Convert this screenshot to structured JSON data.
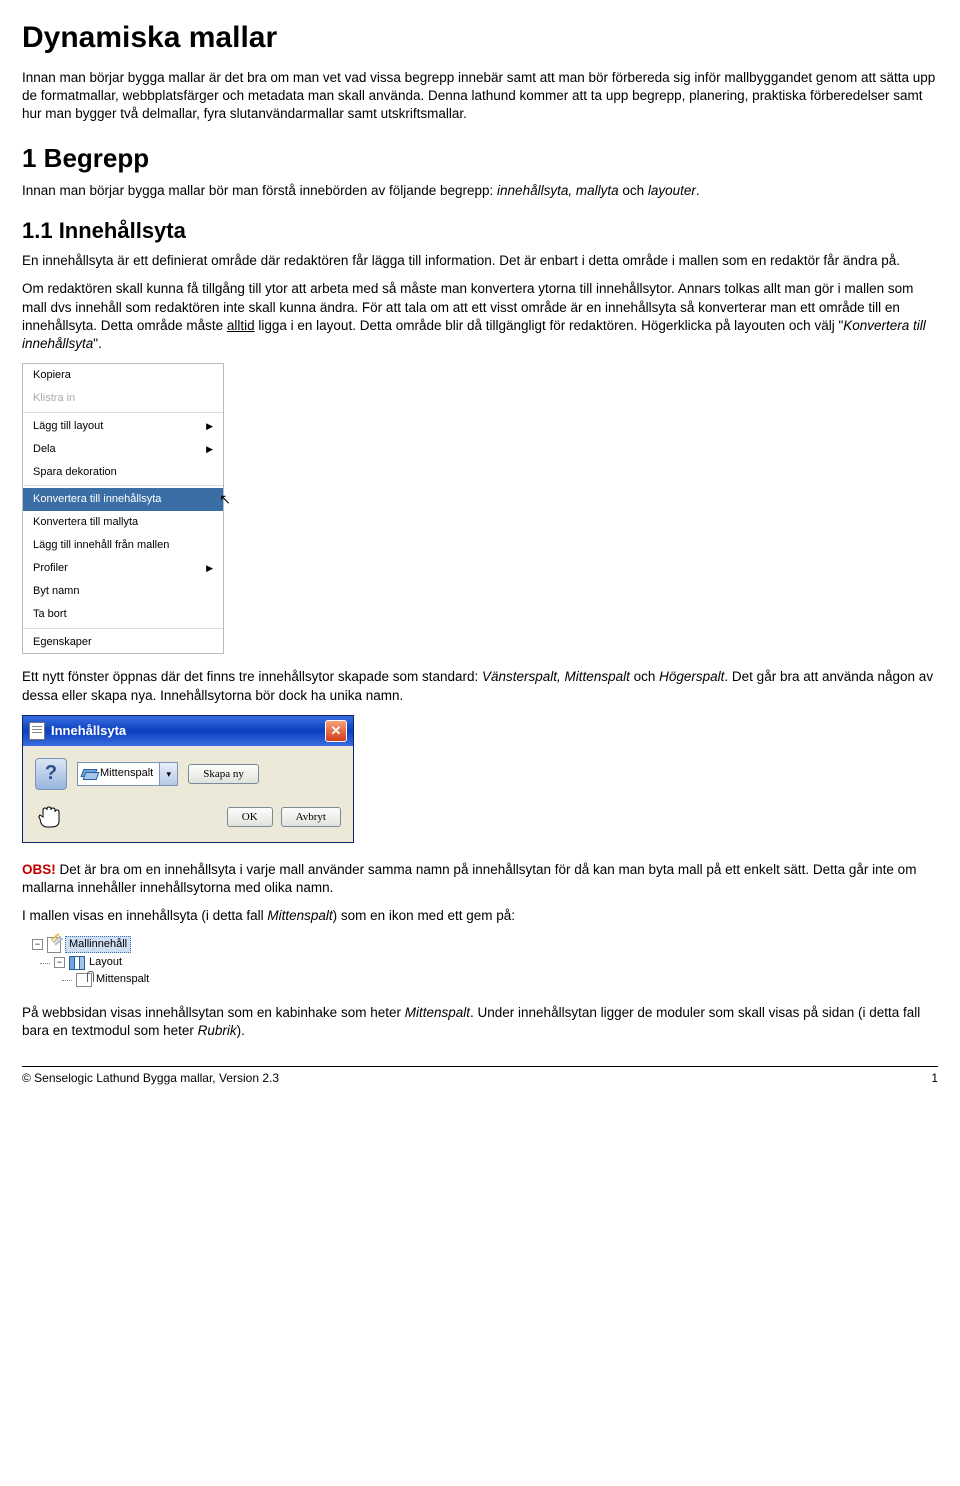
{
  "title": "Dynamiska mallar",
  "intro_p1": "Innan man börjar bygga mallar är det bra om man vet vad vissa begrepp innebär samt att man bör förbereda sig inför mallbyggandet genom att sätta upp de formatmallar, webbplatsfärger och metadata man skall använda. Denna lathund kommer att ta upp begrepp, planering, praktiska förberedelser samt hur man bygger två delmallar, fyra slutanvändarmallar samt utskriftsmallar.",
  "s1_heading": "1 Begrepp",
  "s1_p1a": "Innan man börjar bygga mallar bör man förstå innebörden av följande begrepp: ",
  "s1_p1b_em": "innehållsyta, mallyta",
  "s1_p1c": " och ",
  "s1_p1d_em": "layouter",
  "s1_p1e": ".",
  "s11_heading": "1.1 Innehållsyta",
  "s11_p1": "En innehållsyta är ett definierat område där redaktören får lägga till information. Det är enbart i detta område  i mallen som en redaktör får ändra på.",
  "s11_p2a": "Om redaktören skall kunna få tillgång till ytor att arbeta med så måste man konvertera ytorna till innehållsytor. Annars tolkas allt man gör i mallen som mall dvs innehåll som redaktören inte skall kunna ändra. För att tala om att ett visst område är en innehållsyta så konverterar man ett område till en innehållsyta. Detta område måste ",
  "s11_p2b_u": "alltid",
  "s11_p2c": " ligga i en layout. Detta område blir då tillgängligt för redaktören. Högerklicka på layouten och välj \"",
  "s11_p2d_em": "Konvertera till innehållsyta",
  "s11_p2e": "\".",
  "context_menu": {
    "items": [
      {
        "label": "Kopiera",
        "submenu": false,
        "disabled": false
      },
      {
        "label": "Klistra in",
        "submenu": false,
        "disabled": true
      }
    ],
    "items2": [
      {
        "label": "Lägg till layout",
        "submenu": true
      },
      {
        "label": "Dela",
        "submenu": true
      },
      {
        "label": "Spara dekoration",
        "submenu": false
      }
    ],
    "items3": [
      {
        "label": "Konvertera till innehållsyta",
        "submenu": false,
        "selected": true
      },
      {
        "label": "Konvertera till mallyta",
        "submenu": false
      },
      {
        "label": "Lägg till innehåll från mallen",
        "submenu": false
      },
      {
        "label": "Profiler",
        "submenu": true
      },
      {
        "label": "Byt namn",
        "submenu": false
      },
      {
        "label": "Ta bort",
        "submenu": false
      }
    ],
    "items4": [
      {
        "label": "Egenskaper",
        "submenu": false
      }
    ]
  },
  "s11_p3a": "Ett nytt fönster öppnas där det finns tre innehållsytor skapade som standard: ",
  "s11_p3b_em": "Vänsterspalt, Mittenspalt",
  "s11_p3c": " och ",
  "s11_p3d_em": "Högerspalt",
  "s11_p3e": ". Det går bra att använda någon av dessa eller skapa nya. Innehållsytorna bör dock ha unika namn.",
  "dialog": {
    "title": "Innehållsyta",
    "select_value": "Mittenspalt",
    "btn_create": "Skapa ny",
    "btn_ok": "OK",
    "btn_cancel": "Avbryt"
  },
  "obs_label": "OBS!",
  "s11_p4": " Det är bra om en innehållsyta i varje mall använder samma namn på innehållsytan för då kan man byta mall på ett enkelt sätt. Detta går inte om mallarna innehåller innehållsytorna med olika namn.",
  "s11_p5a": "I mallen visas en innehållsyta (i detta fall ",
  "s11_p5b_em": "Mittenspalt",
  "s11_p5c": ") som en ikon med ett gem på:",
  "tree": {
    "root": "Mallinnehåll",
    "child1": "Layout",
    "child2": "Mittenspalt"
  },
  "s11_p6a": "På webbsidan visas innehållsytan som en kabinhake som heter ",
  "s11_p6b_em": "Mittenspalt",
  "s11_p6c": ". Under innehållsytan ligger de moduler som skall visas på sidan (i detta fall bara en textmodul som heter ",
  "s11_p6d_em": "Rubrik",
  "s11_p6e": ").",
  "footer_left": "© Senselogic Lathund Bygga mallar, Version 2.3",
  "footer_right": "1"
}
